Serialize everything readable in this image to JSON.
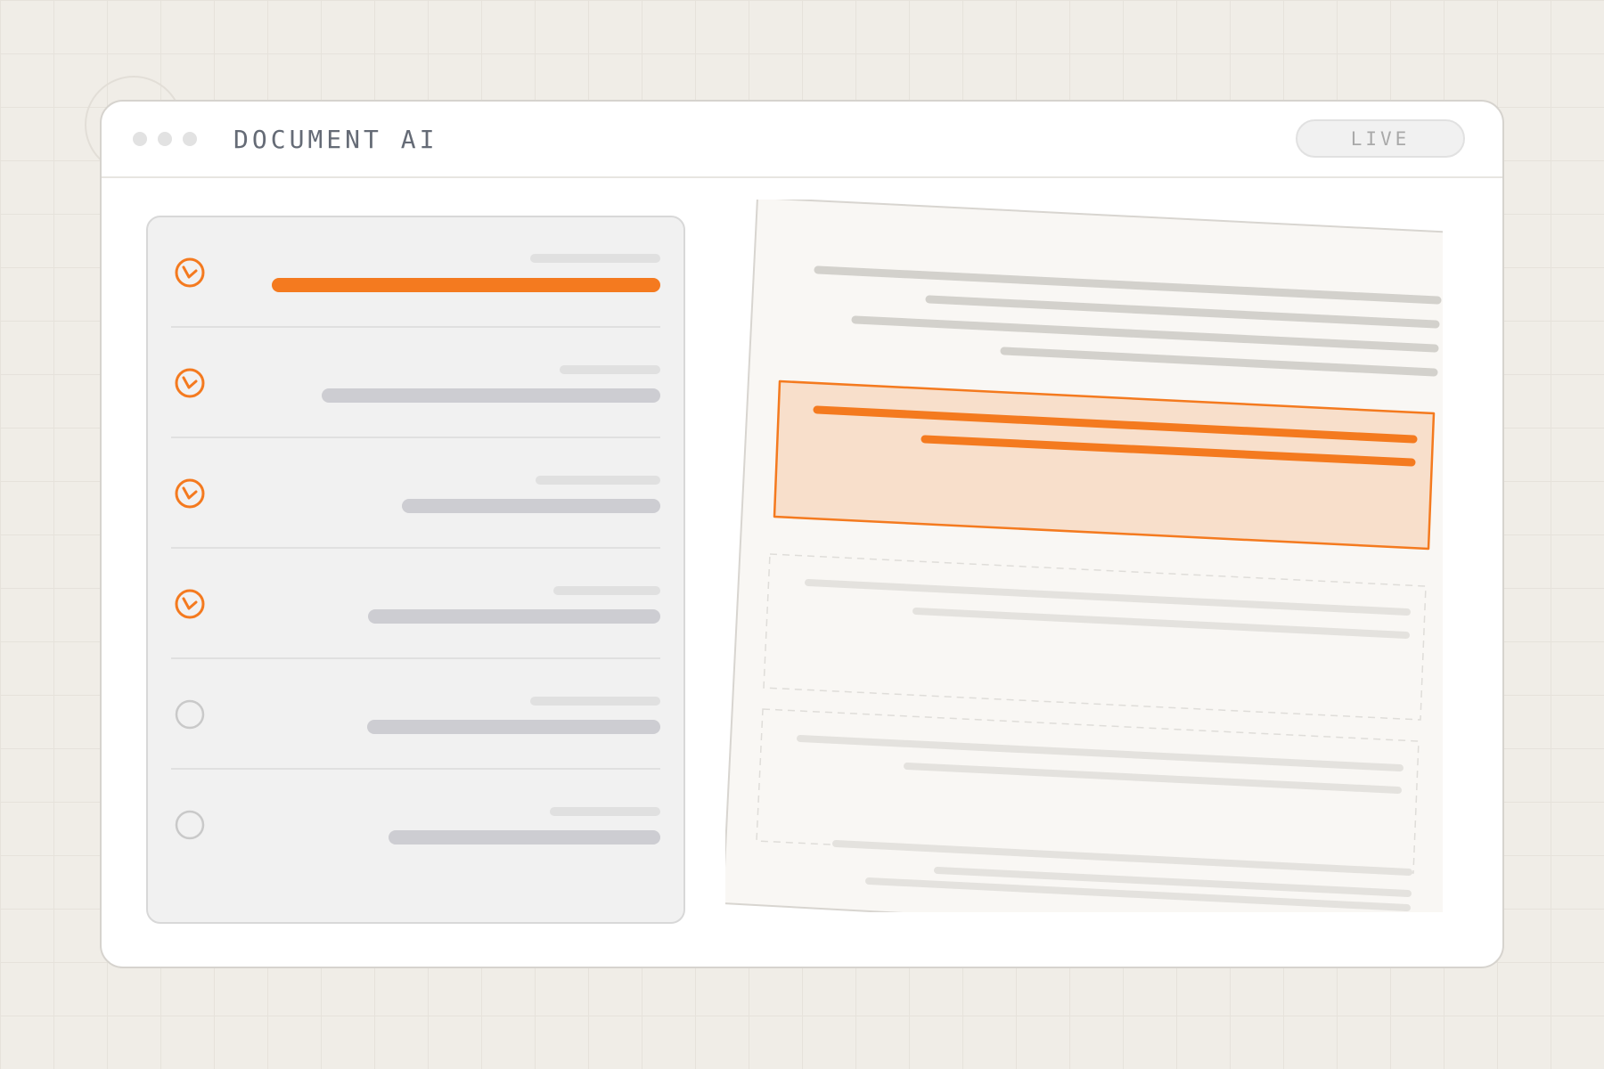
{
  "window": {
    "title": "DOCUMENT AI",
    "status_badge": "LIVE"
  },
  "colors": {
    "accent": "#f47a1f",
    "accent_fill": "#f8dfcb",
    "muted_bar": "#cdcdd2",
    "light_bar": "#e0e0e0",
    "paper": "#f9f7f4"
  },
  "checklist": {
    "items": [
      {
        "state": "checked",
        "active": true,
        "icon": "check-circle-icon"
      },
      {
        "state": "checked",
        "active": false,
        "icon": "check-circle-icon"
      },
      {
        "state": "checked",
        "active": false,
        "icon": "check-circle-icon"
      },
      {
        "state": "checked",
        "active": false,
        "icon": "check-circle-icon"
      },
      {
        "state": "unchecked",
        "active": false,
        "icon": "empty-circle-icon"
      },
      {
        "state": "unchecked",
        "active": false,
        "icon": "empty-circle-icon"
      }
    ]
  },
  "document": {
    "highlighted_block": 1,
    "pending_blocks": [
      2,
      3
    ]
  }
}
